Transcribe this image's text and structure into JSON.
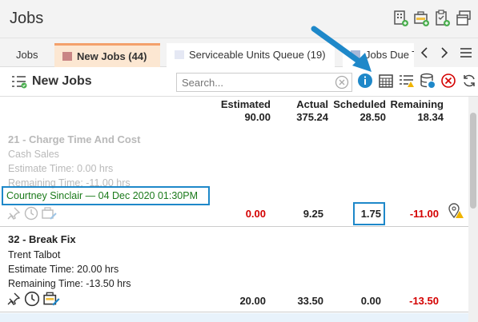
{
  "window": {
    "title": "Jobs"
  },
  "tabs": [
    {
      "label": "Jobs"
    },
    {
      "label": "New Jobs (44)",
      "color": "#c98585"
    },
    {
      "label": "Serviceable Units Queue (19)",
      "color": "#e5e8f4"
    },
    {
      "label": "Jobs Due To",
      "color": "#a8b8d8"
    }
  ],
  "toolbar": {
    "title": "New Jobs",
    "search_placeholder": "Search..."
  },
  "summary": {
    "columns": [
      {
        "label": "Estimated",
        "total": "90.00"
      },
      {
        "label": "Actual",
        "total": "375.24"
      },
      {
        "label": "Scheduled",
        "total": "28.50"
      },
      {
        "label": "Remaining",
        "total": "18.34"
      }
    ]
  },
  "jobs": [
    {
      "title": "21 - Charge Time And Cost",
      "customer": "Cash Sales",
      "estimate": "Estimate Time: 0.00 hrs",
      "remaining": "Remaining Time: -11.00 hrs",
      "assignment": "Courtney Sinclair — 04 Dec 2020 01:30PM",
      "estimated": "0.00",
      "actual": "9.25",
      "scheduled": "1.75",
      "remaining_val": "-11.00"
    },
    {
      "title": "32 - Break Fix",
      "customer": "Trent Talbot",
      "estimate": "Estimate Time: 20.00 hrs",
      "remaining": "Remaining Time: -13.50 hrs",
      "estimated": "20.00",
      "actual": "33.50",
      "scheduled": "0.00",
      "remaining_val": "-13.50"
    }
  ],
  "colors": {
    "accent": "#1e88c9",
    "negative": "#d40000",
    "tab_active": "#fce7d2",
    "assignment": "#1b7a1b"
  }
}
